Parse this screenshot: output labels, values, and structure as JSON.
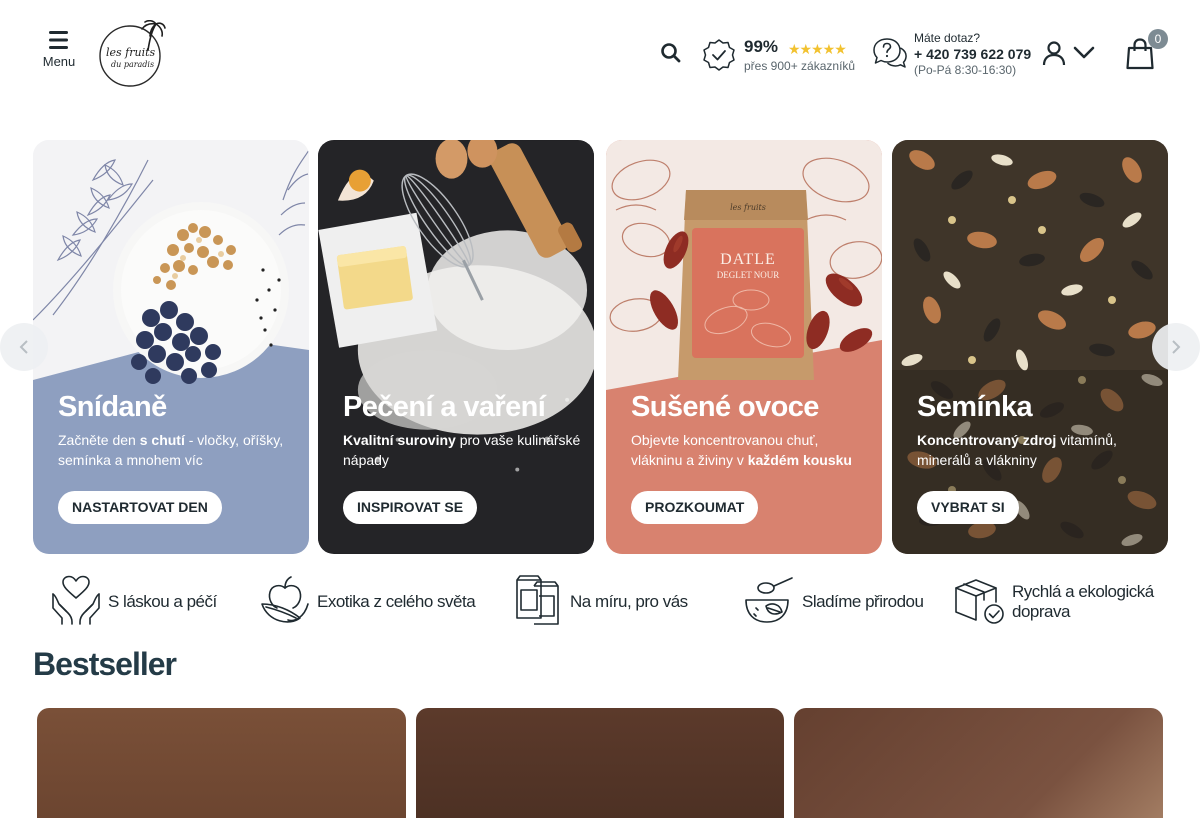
{
  "header": {
    "menu_label": "Menu",
    "logo_line1": "les fruits",
    "logo_line2": "du paradis",
    "rating_percent": "99%",
    "rating_stars": "★★★★★",
    "rating_sub": "přes 900+ zákazníků",
    "contact_question": "Máte dotaz?",
    "contact_phone": "+ 420 739 622 079",
    "contact_hours": "(Po-Pá 8:30-16:30)",
    "cart_count": "0"
  },
  "colors": {
    "text_dark": "#1f2a30",
    "star_gold": "#f2c230",
    "heading": "#243b47"
  },
  "categories": [
    {
      "title": "Snídaně",
      "desc_pre": "Začněte den ",
      "desc_bold": "s chutí",
      "desc_post": " - vločky, oříšky, semínka a mnohem víc",
      "button": "NASTARTOVAT DEN"
    },
    {
      "title": "Pečení a vaření",
      "desc_bold": "Kvalitní suroviny",
      "desc_post": " pro vaše kulinářské nápady",
      "button": "INSPIROVAT SE"
    },
    {
      "title": "Sušené ovoce",
      "desc_pre": "Objevte koncentrovanou chuť, vlákninu a živiny v ",
      "desc_bold": "každém kousku",
      "button": "PROZKOUMAT",
      "package_title": "DATLE",
      "package_sub": "DEGLET NOUR"
    },
    {
      "title": "Semínka",
      "desc_bold": "Koncentrovaný zdroj",
      "desc_post": " vitamínů, minerálů a vlákniny",
      "button": "VYBRAT SI"
    }
  ],
  "usps": [
    {
      "icon": "hands-heart-icon",
      "label": "S láskou a péčí"
    },
    {
      "icon": "apple-leaf-icon",
      "label": "Exotika z celého světa"
    },
    {
      "icon": "packages-icon",
      "label": "Na míru, pro vás"
    },
    {
      "icon": "scoop-bowl-icon",
      "label": "Sladíme přirodou"
    },
    {
      "icon": "box-check-icon",
      "label": "Rychlá a ekologická doprava"
    }
  ],
  "bestseller": {
    "title": "Bestseller"
  }
}
